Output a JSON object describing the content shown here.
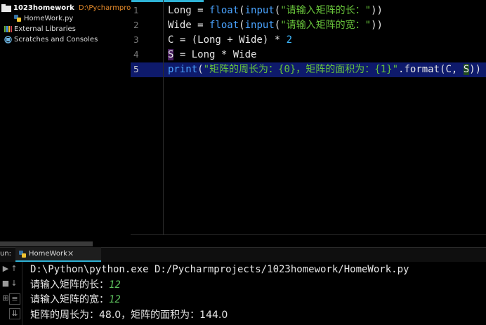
{
  "project": {
    "name": "1023homework",
    "path": "D:\\Pycharmprojects\\",
    "file": "HomeWork.py",
    "external_libraries": "External Libraries",
    "scratches": "Scratches and Consoles"
  },
  "editor": {
    "line_numbers": [
      "1",
      "2",
      "3",
      "4",
      "5"
    ],
    "lines": [
      {
        "a": "Long = ",
        "fn1": "float",
        "p1": "(",
        "fn2": "input",
        "p2": "(",
        "s": "\"请输入矩阵的长：\"",
        "end": "))"
      },
      {
        "a": "Wide = ",
        "fn1": "float",
        "p1": "(",
        "fn2": "input",
        "p2": "(",
        "s": "\"请输入矩阵的宽：\"",
        "end": "))"
      },
      {
        "a": "C = (Long + Wide) * ",
        "n": "2"
      },
      {
        "v": "S",
        "rest": " = Long * Wide"
      },
      {
        "fn": "print",
        "p": "(",
        "s": "\"矩阵的周长为：{0}，矩阵的面积为：{1}\"",
        "mid": ".format(C, ",
        "v": "S",
        "end": "))"
      }
    ]
  },
  "run": {
    "label": "un:",
    "tab_name": "HomeWork",
    "close": "✕",
    "console": {
      "command": "D:\\Python\\python.exe D:/Pycharmprojects/1023homework/HomeWork.py",
      "prompt1": "请输入矩阵的长：",
      "input1": "12",
      "prompt2": "请输入矩阵的宽：",
      "input2": "12",
      "result": "矩阵的周长为：48.0，矩阵的面积为：144.0"
    }
  },
  "colors": {
    "accent": "#2fb3d6",
    "current_line": "#0e1a6b",
    "string": "#67c23a",
    "function": "#4aa3ff"
  }
}
